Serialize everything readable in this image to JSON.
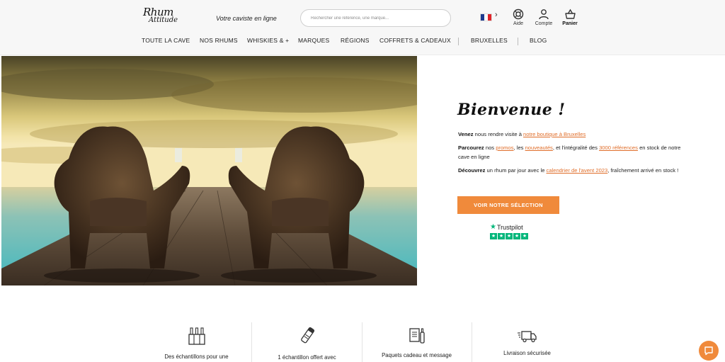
{
  "header": {
    "logo": {
      "line1": "Rhum",
      "line2": "Attitude"
    },
    "tagline": "Votre caviste en ligne",
    "search": {
      "placeholder": "Rechercher une référence, une marque..."
    },
    "language": {
      "flag_icon": "france-flag-icon",
      "chevron_icon": "chevron-right-icon"
    },
    "icons": [
      {
        "label": "Aide",
        "icon": "lifebuoy-icon"
      },
      {
        "label": "Compte",
        "icon": "user-icon"
      },
      {
        "label": "Panier",
        "icon": "basket-icon"
      }
    ]
  },
  "nav": {
    "items": [
      "TOUTE LA CAVE",
      "NOS RHUMS",
      "WHISKIES & +",
      "MARQUES",
      "RÉGIONS",
      "COFFRETS & CADEAUX",
      "BRUXELLES",
      "BLOG"
    ]
  },
  "welcome": {
    "title": "Bienvenue !",
    "line1": {
      "bold": "Venez",
      "text": " nous rendre visite à ",
      "link": "notre boutique à Bruxelles"
    },
    "line2": {
      "bold": "Parcourez",
      "text1": " nos ",
      "link1": "promos",
      "text2": ", les ",
      "link2": "nouveautés",
      "text3": ", et l'intégralité des ",
      "link3": "3000 références",
      "text4": " en stock de notre cave en ligne"
    },
    "line3": {
      "bold": "Découvrez",
      "text1": " un rhum par jour avec le ",
      "link1": "calendrier de l'avent 2023",
      "text2": ", fraîchement arrivé en stock !"
    },
    "cta": "VOIR NOTRE SÉLECTION",
    "trustpilot": {
      "name": "Trustpilot",
      "stars": 5
    }
  },
  "features": [
    {
      "label": "Des échantillons pour une",
      "icon": "bottles-rack-icon"
    },
    {
      "label": "1 échantillon offert avec",
      "icon": "sample-tube-icon"
    },
    {
      "label": "Paquets cadeau et message",
      "icon": "gift-message-icon"
    },
    {
      "label": "Livraison sécurisée",
      "icon": "delivery-truck-icon"
    }
  ],
  "chat": {
    "icon": "chat-icon"
  },
  "colors": {
    "accent": "#f08a3b",
    "link": "#e06e2a",
    "trustpilot": "#00b67a"
  }
}
